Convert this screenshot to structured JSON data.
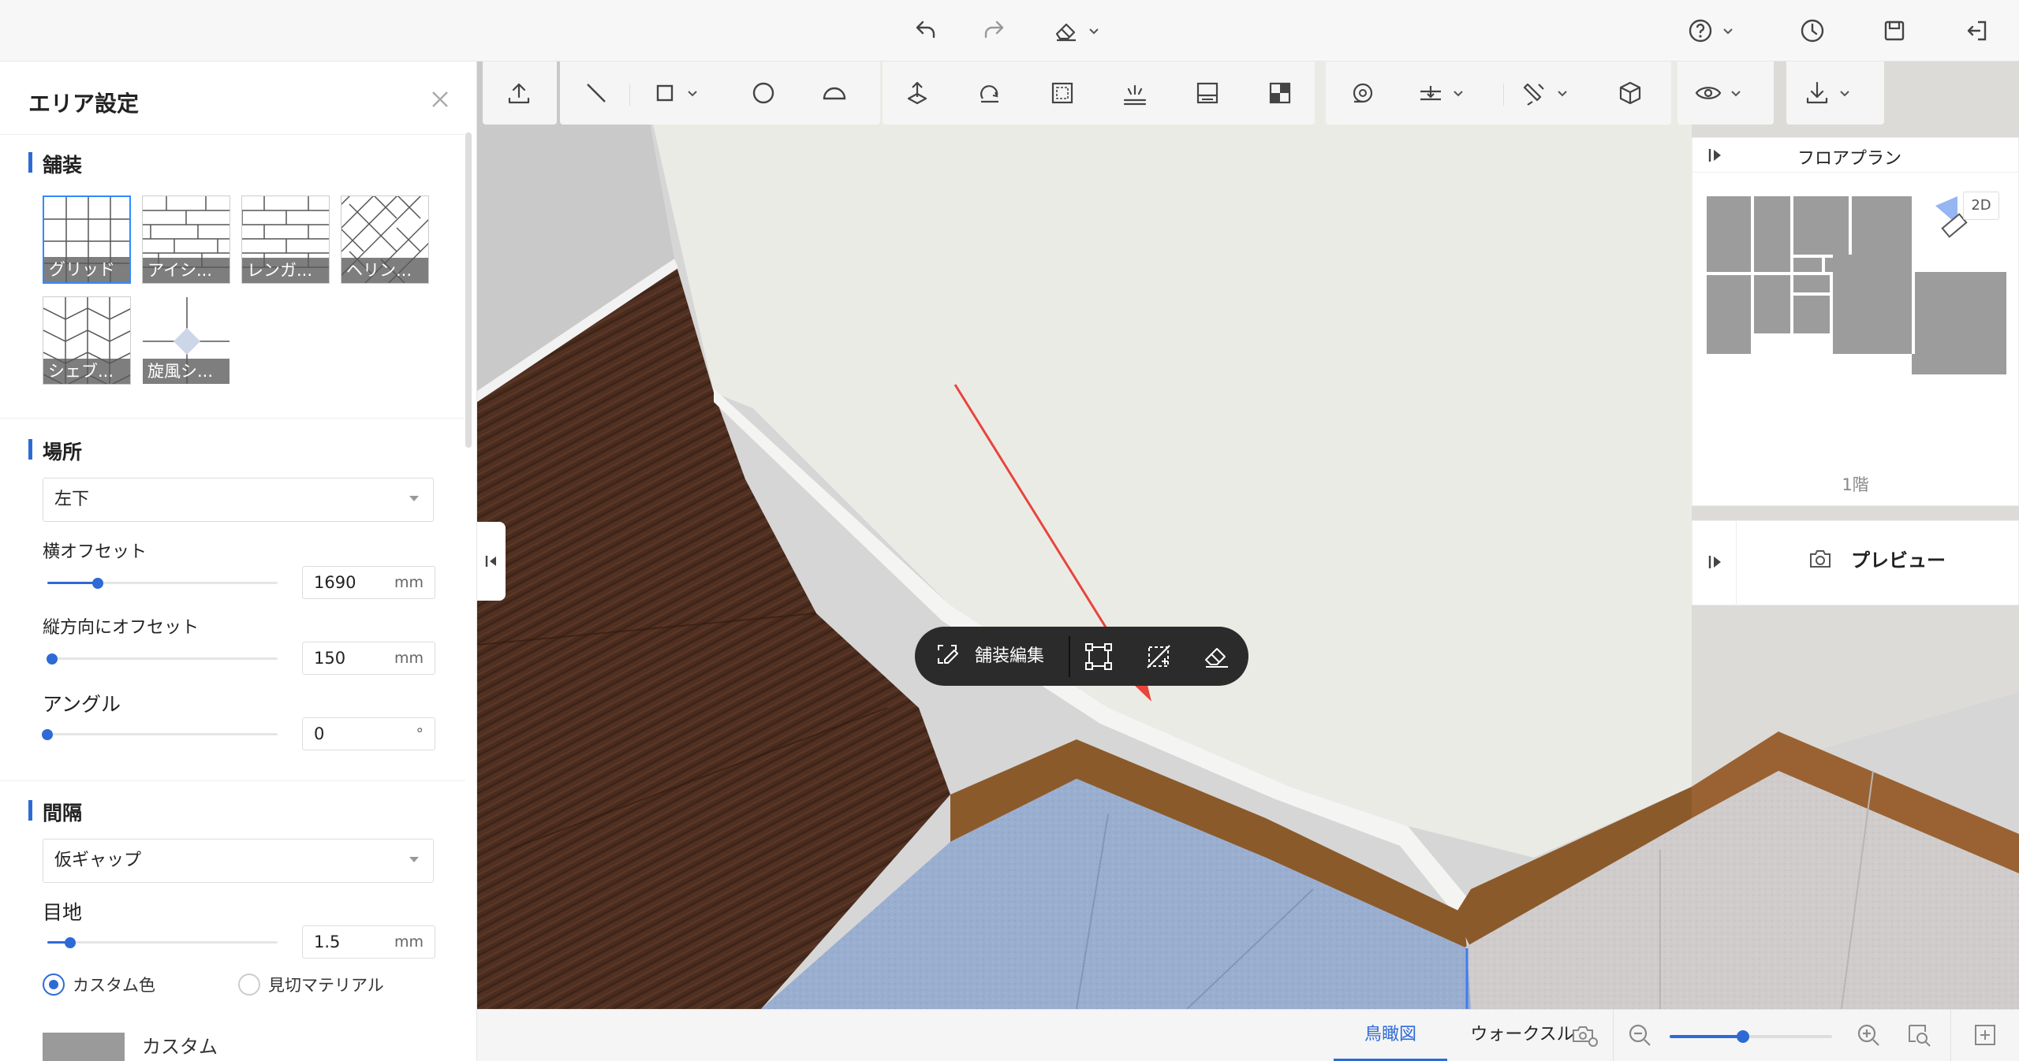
{
  "topbar": {
    "undo_icon": "undo-icon",
    "redo_icon": "redo-icon",
    "eraser_icon": "eraser-icon",
    "help_icon": "help-icon",
    "history_icon": "clock-icon",
    "save_icon": "save-icon",
    "exit_icon": "exit-icon"
  },
  "left_panel": {
    "title": "エリア設定",
    "paving": {
      "title": "舗装",
      "patterns": [
        {
          "label": "グリッド",
          "selected": true
        },
        {
          "label": "アイシ...",
          "selected": false
        },
        {
          "label": "レンガ...",
          "selected": false
        },
        {
          "label": "ヘリン...",
          "selected": false
        },
        {
          "label": "シェブ...",
          "selected": false
        },
        {
          "label": "旋風シ...",
          "selected": false
        }
      ]
    },
    "location": {
      "title": "場所",
      "anchor": "左下",
      "h_offset_label": "横オフセット",
      "h_offset_value": "1690",
      "h_offset_unit": "mm",
      "h_offset_level": 0.22,
      "v_offset_label": "縦方向にオフセット",
      "v_offset_value": "150",
      "v_offset_unit": "mm",
      "v_offset_level": 0.02,
      "angle_label": "アングル",
      "angle_value": "0",
      "angle_unit": "°",
      "angle_level": 0.0
    },
    "gap": {
      "title": "間隔",
      "type": "仮ギャップ",
      "joint_label": "目地",
      "joint_value": "1.5",
      "joint_unit": "mm",
      "joint_level": 0.1,
      "radio_custom": "カスタム色",
      "radio_material": "見切マテリアル",
      "custom_label": "カスタム",
      "custom_color": "#9a9a9a"
    }
  },
  "floorplan": {
    "title": "フロアプラン",
    "badge": "2D",
    "floor": "1階"
  },
  "preview": {
    "label": "プレビュー"
  },
  "popup": {
    "edit_label": "舗装編集"
  },
  "bottombar": {
    "tab_birdseye": "鳥瞰図",
    "tab_walkthrough": "ウォークスルー",
    "zoom_level": 0.45
  },
  "colors": {
    "accent": "#2e6ad6",
    "popup_bg": "#2b2b2b",
    "annotation_arrow": "#e8453c"
  }
}
